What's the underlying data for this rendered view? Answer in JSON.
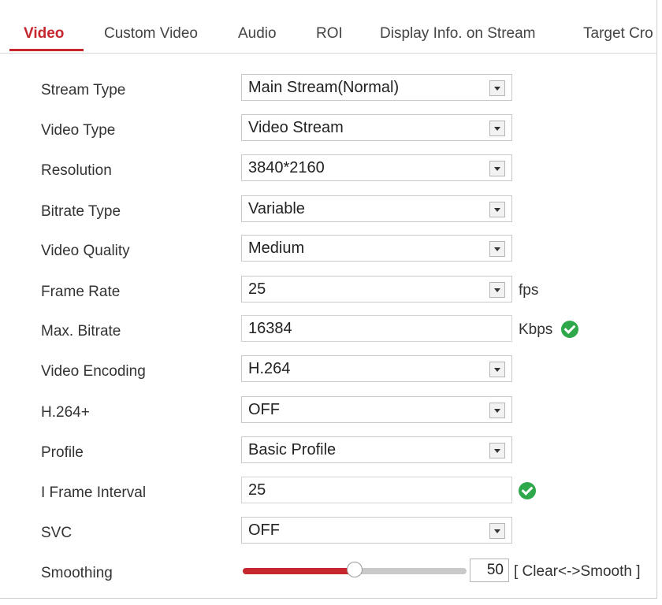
{
  "tabs": [
    {
      "label": "Video",
      "active": true
    },
    {
      "label": "Custom Video"
    },
    {
      "label": "Audio"
    },
    {
      "label": "ROI"
    },
    {
      "label": "Display Info. on Stream"
    },
    {
      "label": "Target Cro"
    }
  ],
  "colors": {
    "accent": "#c6262e",
    "success": "#2ea84a"
  },
  "form": {
    "stream_type": {
      "label": "Stream Type",
      "value": "Main Stream(Normal)"
    },
    "video_type": {
      "label": "Video Type",
      "value": "Video Stream"
    },
    "resolution": {
      "label": "Resolution",
      "value": "3840*2160"
    },
    "bitrate_type": {
      "label": "Bitrate Type",
      "value": "Variable"
    },
    "video_quality": {
      "label": "Video Quality",
      "value": "Medium"
    },
    "frame_rate": {
      "label": "Frame Rate",
      "value": "25",
      "unit": "fps"
    },
    "max_bitrate": {
      "label": "Max. Bitrate",
      "value": "16384",
      "unit": "Kbps",
      "status_icon": "check-circle-icon"
    },
    "video_encoding": {
      "label": "Video Encoding",
      "value": "H.264"
    },
    "h264_plus": {
      "label": "H.264+",
      "value": "OFF"
    },
    "profile": {
      "label": "Profile",
      "value": "Basic Profile"
    },
    "i_frame_interval": {
      "label": "I Frame Interval",
      "value": "25",
      "status_icon": "check-circle-icon"
    },
    "svc": {
      "label": "SVC",
      "value": "OFF"
    },
    "smoothing": {
      "label": "Smoothing",
      "value": "50",
      "max": 100,
      "range_label": "[ Clear<->Smooth ]"
    }
  }
}
